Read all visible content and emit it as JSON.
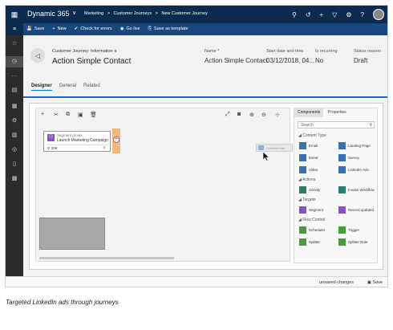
{
  "topbar": {
    "app_name": "Dynamic 365",
    "breadcrumb": [
      "Marketing",
      ">",
      "Customer Journeys",
      ">",
      "New Customer Journey"
    ],
    "icons": [
      "search-icon",
      "history-icon",
      "plus-icon",
      "filter-icon",
      "gear-icon",
      "help-icon",
      "user-avatar"
    ]
  },
  "commands": [
    {
      "icon": "💾",
      "label": "Save"
    },
    {
      "icon": "+",
      "label": "New"
    },
    {
      "icon": "✔",
      "label": "Check for errors"
    },
    {
      "icon": "◉",
      "label": "Go live"
    },
    {
      "icon": "⎘",
      "label": "Save as template"
    }
  ],
  "header": {
    "form_selector": "Customer Journey: Information",
    "record_title": "Action Simple Contact",
    "fields": [
      {
        "label": "Name *",
        "value": "Action Simple Contact"
      },
      {
        "label": "Start date and time",
        "value": "03/12/2018, 04..."
      },
      {
        "label": "Is recurring",
        "value": "No"
      },
      {
        "label": "Status reason",
        "value": "Draft"
      }
    ]
  },
  "tabs": [
    "Designer",
    "General",
    "Related"
  ],
  "canvas": {
    "segment_tile": {
      "type": "Segment group",
      "name": "Launch Marketing Campaign",
      "count": "20K"
    },
    "dragging_tile_label": "LinkedIn Ads"
  },
  "side_panel": {
    "tabs": [
      "Components",
      "Properties"
    ],
    "search_placeholder": "Search",
    "groups": [
      {
        "title": "◢ Content Type",
        "items": [
          {
            "label": "Email",
            "color": "#3b6fb6"
          },
          {
            "label": "Landing Page",
            "color": "#3b6fb6"
          },
          {
            "label": "Event",
            "color": "#3b6fb6"
          },
          {
            "label": "Survey",
            "color": "#3b6fb6"
          },
          {
            "label": "Video",
            "color": "#3b6fb6"
          },
          {
            "label": "LinkedIn Ads",
            "color": "#3b6fb6"
          }
        ]
      },
      {
        "title": "◢ Actions",
        "items": [
          {
            "label": "Activity",
            "color": "#2e7d6b"
          },
          {
            "label": "Invoke Workflow",
            "color": "#2e7d6b"
          }
        ]
      },
      {
        "title": "◢ Targets",
        "items": [
          {
            "label": "Segment",
            "color": "#8c4ec7"
          },
          {
            "label": "Record updated",
            "color": "#8c4ec7"
          }
        ]
      },
      {
        "title": "◢ Flow Control",
        "items": [
          {
            "label": "Scheduler",
            "color": "#4b9a3a"
          },
          {
            "label": "Trigger",
            "color": "#4b9a3a"
          },
          {
            "label": "Splitter",
            "color": "#4b9a3a"
          },
          {
            "label": "Splitter Rule",
            "color": "#4b9a3a"
          }
        ]
      }
    ]
  },
  "statusbar": {
    "unsaved": "unsaved changes",
    "save": "Save"
  },
  "caption": "Targeted LinkedIn ads through journeys"
}
